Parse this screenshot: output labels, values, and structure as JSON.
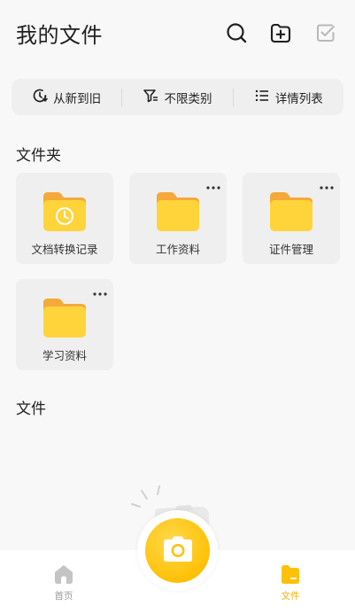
{
  "header": {
    "title": "我的文件",
    "icons": [
      "search-icon",
      "add-folder-icon",
      "multi-select-icon"
    ]
  },
  "toolbar": {
    "sort_label": "从新到旧",
    "filter_label": "不限类别",
    "view_label": "详情列表"
  },
  "folders_section": {
    "title": "文件夹",
    "items": [
      {
        "label": "文档转换记录",
        "icon": "clock-folder-icon",
        "has_more": false
      },
      {
        "label": "工作资料",
        "icon": "folder-icon",
        "has_more": true
      },
      {
        "label": "证件管理",
        "icon": "folder-icon",
        "has_more": true
      },
      {
        "label": "学习资料",
        "icon": "folder-icon",
        "has_more": true
      }
    ]
  },
  "files_section": {
    "title": "文件"
  },
  "bottom_nav": {
    "home_label": "首页",
    "files_label": "文件",
    "active": "files"
  },
  "colors": {
    "accent": "#ffc107",
    "folder_front": "#ffd43b",
    "folder_back": "#f4a93a",
    "inactive": "#c4c4c4"
  }
}
